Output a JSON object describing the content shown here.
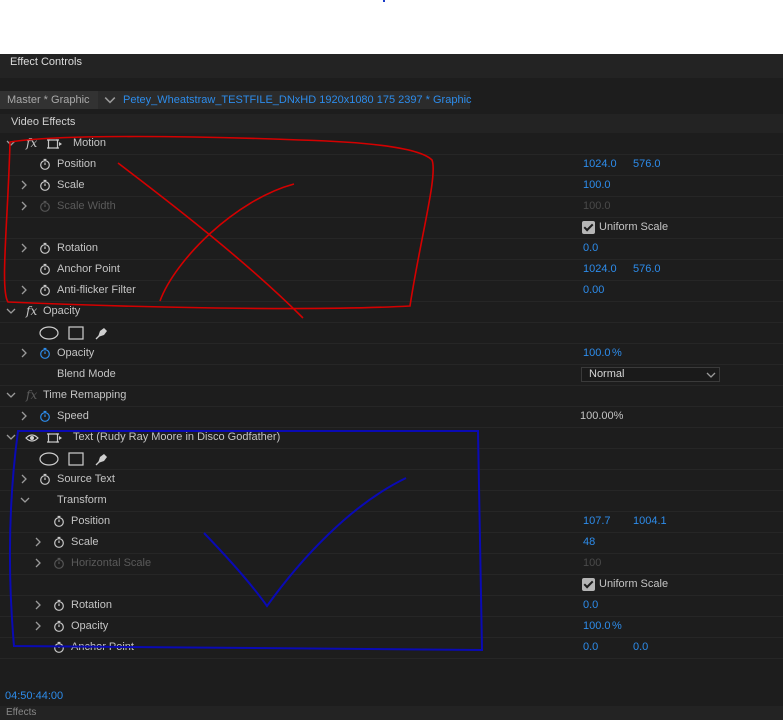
{
  "panel": {
    "title": "Effect Controls"
  },
  "clip": {
    "master_label": "Master * Graphic",
    "name": "Petey_Wheatstraw_TESTFILE_DNxHD 1920x1080 175 2397 * Graphic"
  },
  "video_effects_label": "Video Effects",
  "motion": {
    "label": "Motion",
    "position": {
      "label": "Position",
      "x": "1024.0",
      "y": "576.0"
    },
    "scale": {
      "label": "Scale",
      "value": "100.0"
    },
    "scale_width": {
      "label": "Scale Width",
      "value": "100.0"
    },
    "uniform_scale": {
      "label": "Uniform Scale",
      "checked": true
    },
    "rotation": {
      "label": "Rotation",
      "value": "0.0"
    },
    "anchor_point": {
      "label": "Anchor Point",
      "x": "1024.0",
      "y": "576.0"
    },
    "anti_flicker": {
      "label": "Anti-flicker Filter",
      "value": "0.00"
    }
  },
  "opacity": {
    "label": "Opacity",
    "opacity_row": {
      "label": "Opacity",
      "value": "100.0",
      "unit": "%"
    },
    "blend_mode": {
      "label": "Blend Mode",
      "value": "Normal"
    }
  },
  "time_remapping": {
    "label": "Time Remapping",
    "speed": {
      "label": "Speed",
      "value": "100.00%"
    }
  },
  "text_layer": {
    "label": "Text (Rudy Ray Moore in Disco Godfather)",
    "source_text": {
      "label": "Source Text"
    },
    "transform": {
      "label": "Transform"
    },
    "position": {
      "label": "Position",
      "x": "107.7",
      "y": "1004.1"
    },
    "scale": {
      "label": "Scale",
      "value": "48"
    },
    "horizontal_scale": {
      "label": "Horizontal Scale",
      "value": "100"
    },
    "uniform_scale": {
      "label": "Uniform Scale",
      "checked": true
    },
    "rotation": {
      "label": "Rotation",
      "value": "0.0"
    },
    "opacity": {
      "label": "Opacity",
      "value": "100.0",
      "unit": "%"
    },
    "anchor_point": {
      "label": "Anchor Point",
      "x": "0.0",
      "y": "0.0"
    }
  },
  "timecode": "04:50:44:00",
  "bottom_tab": "Effects",
  "colors": {
    "accent_blue": "#2d8ceb",
    "panel_bg": "#1d1d1d",
    "red_markup": "#d40000",
    "blue_markup": "#0a0ab4"
  }
}
